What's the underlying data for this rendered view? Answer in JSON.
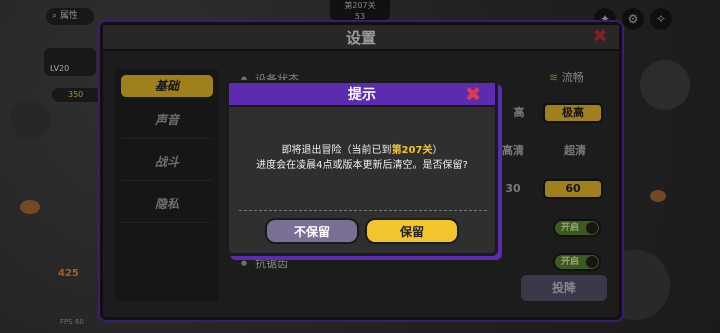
{
  "hud": {
    "search_label": "属性",
    "wave_label": "第207关",
    "wave_sub": "53",
    "player_level": "LV20",
    "coins": "350",
    "score": "425",
    "fps": "FPS 60"
  },
  "settings": {
    "title": "设置",
    "tabs": [
      "基础",
      "声音",
      "战斗",
      "隐私"
    ],
    "rows": {
      "device_status_label": "设备状态",
      "device_status_value": "流畅",
      "quality_high": "高",
      "quality_ultra": "极高",
      "res_hd": "高清",
      "res_uhd": "超清",
      "fps_30": "30",
      "fps_60": "60",
      "toggle_1": "开启",
      "toggle_2": "开启",
      "last_label": "抗锯齿"
    },
    "surrender_label": "投降"
  },
  "dialog": {
    "title": "提示",
    "line1_prefix": "即将退出冒险（当前已到",
    "line1_highlight": "第207关",
    "line1_suffix": "）",
    "line2": "进度会在凌晨4点或版本更新后清空。是否保留?",
    "btn_discard": "不保留",
    "btn_keep": "保留"
  },
  "colors": {
    "accent_purple": "#5b2bb0",
    "accent_yellow": "#f3c52d",
    "close_red": "#e03b4a"
  }
}
